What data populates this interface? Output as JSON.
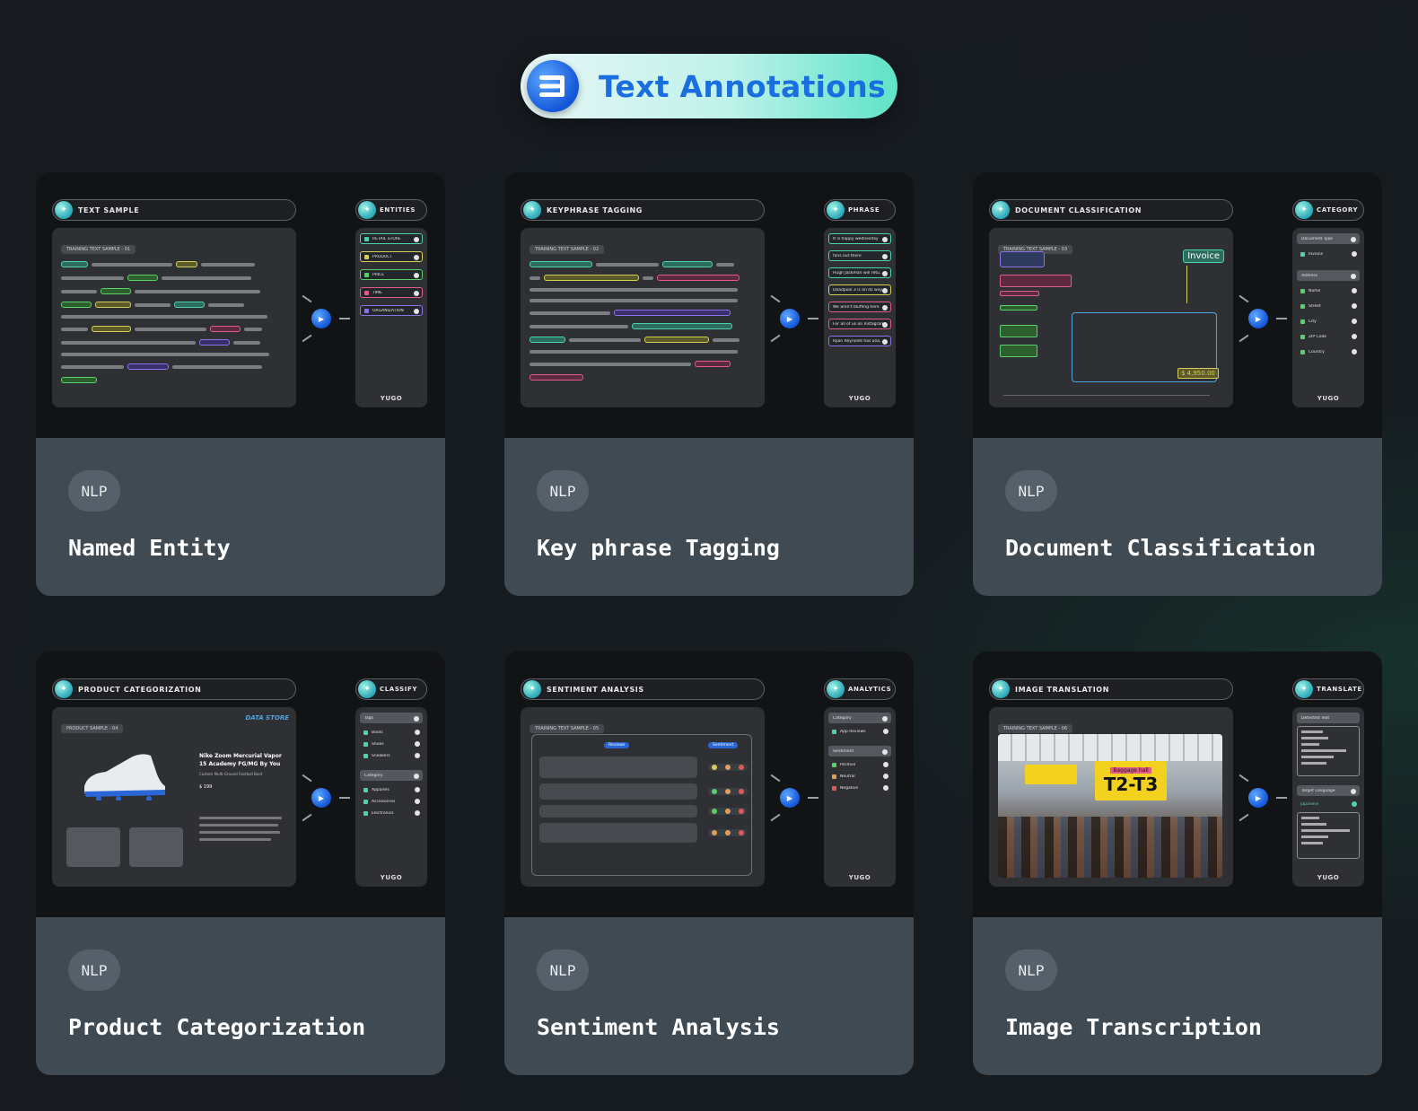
{
  "header": {
    "title": "Text Annotations",
    "logo_icon": "annotation-logo-icon"
  },
  "colors": {
    "accent_blue": "#1a6fe0",
    "pill_gradient_end": "#5fe3c8",
    "card_footer": "#3f4a53",
    "tag_bg": "#56606a"
  },
  "cards": [
    {
      "tag": "NLP",
      "title": "Named Entity",
      "panel_title": "TEXT SAMPLE",
      "side_title": "ENTITIES",
      "sample": "TRAINING TEXT SAMPLE - 01",
      "side_items": [
        "RETAIL STORE",
        "PRODUCT",
        "PRICE",
        "TIME",
        "ORGANIZATION"
      ],
      "brand": "YUGO"
    },
    {
      "tag": "NLP",
      "title": "Key phrase Tagging",
      "panel_title": "KEYPHRASE TAGGING",
      "side_title": "PHRASE",
      "sample": "TRAINING TEXT SAMPLE - 02",
      "side_items": [
        "It is happy wednesday",
        "fans out there",
        "Hugh Jackman will retu..",
        "Deadpool 3 is on its way",
        "We aren't bluffing here",
        "For all of us on Instagram",
        "Ryan Reynolds has ano.."
      ],
      "brand": "YUGO"
    },
    {
      "tag": "NLP",
      "title": "Document Classification",
      "panel_title": "DOCUMENT CLASSIFICATION",
      "side_title": "CATEGORY",
      "sample": "TRAINING TEXT SAMPLE - 03",
      "side_items": [
        "Document Type",
        "Invoice",
        "Address",
        "Name",
        "Street",
        "City",
        "ZIP Code",
        "Country"
      ],
      "doc_label": "Invoice",
      "doc_total": "$ 4,950.00",
      "brand": "YUGO"
    },
    {
      "tag": "NLP",
      "title": "Product Categorization",
      "panel_title": "PRODUCT CATEGORIZATION",
      "side_title": "CLASSIFY",
      "sample": "PRODUCT SAMPLE - 04",
      "store": "DATA STORE",
      "product_name": "Nike Zoom Mercurial Vapor 15 Academy FG/MG By You",
      "product_sub": "Custom Multi-Ground Football Boot",
      "price": "$ 199",
      "side_items": [
        "Tags",
        "Boots",
        "Shoes",
        "Sneakers",
        "Category",
        "Apparels",
        "Accessories",
        "Electronics"
      ],
      "brand": "YUGO"
    },
    {
      "tag": "NLP",
      "title": "Sentiment Analysis",
      "panel_title": "SENTIMENT ANALYSIS",
      "side_title": "ANALYTICS",
      "sample": "TRAINING TEXT SAMPLE - 05",
      "reviews_label": "Reviews",
      "sentiment_label": "Sentiment",
      "side_items": [
        "Category",
        "App Reviews",
        "Sentiment",
        "Positive",
        "Neutral",
        "Negative"
      ],
      "brand": "YUGO"
    },
    {
      "tag": "NLP",
      "title": "Image Transcription",
      "panel_title": "IMAGE TRANSLATION",
      "side_title": "TRANSLATE",
      "sample": "TRAINING TEXT SAMPLE - 06",
      "sign_text": "T2-T3",
      "sign_top": "Baggage hall",
      "side_items": [
        "Detected Text",
        "Target Language",
        "Japanese"
      ],
      "brand": "YUGO"
    }
  ]
}
